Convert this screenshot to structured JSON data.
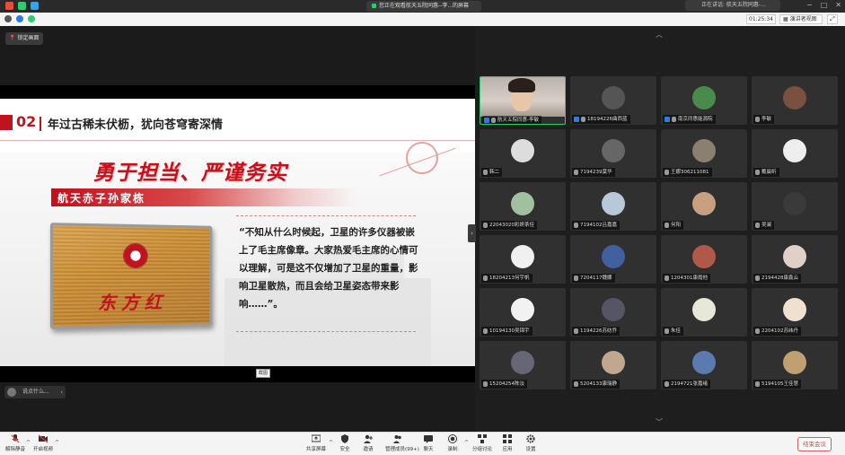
{
  "banner": {
    "text": "您正在观看航天五院同惠--李...的屏幕"
  },
  "speaking": {
    "text": "正在讲话: 航天五院同惠-..."
  },
  "info": {
    "timer": "01:25:34",
    "view_label": "演讲者视图"
  },
  "share": {
    "lock_label": "锁定画面",
    "slide": {
      "section_number": "02",
      "section_title": "年过古稀未伏枥，犹向苍穹寄深情",
      "slogan": "勇于担当、严谨务实",
      "name_banner": "航天赤子孙家栋",
      "plaque_text": "东方红",
      "quote": "“不知从什么时候起，卫星的许多仪器被嵌上了毛主席像章。大家热爱毛主席的心情可以理解，可是这不仅增加了卫星的重量，影响卫星散热，而且会给卫星姿态带来影响……”。"
    },
    "share_tag": "截图",
    "say_placeholder": "说点什么..."
  },
  "gallery": {
    "tiles": [
      {
        "name": "航天五院同惠-李敏",
        "camera": true,
        "host": true,
        "active": true
      },
      {
        "name": "18194226曲西蓝",
        "host": true,
        "color": "#555"
      },
      {
        "name": "南京同惠能源院",
        "host": true,
        "color": "#4a8a4a"
      },
      {
        "name": "李敏",
        "color": "#7a5040"
      },
      {
        "name": "韩二",
        "color": "#ddd"
      },
      {
        "name": "7194239莫华",
        "color": "#666"
      },
      {
        "name": "王娜306211081",
        "color": "#8a8070"
      },
      {
        "name": "戴晨昕",
        "color": "#eee"
      },
      {
        "name": "22043020彩妍茶佳",
        "color": "#a0c0a0"
      },
      {
        "name": "7194102吕嘉嘉",
        "color": "#b8c8d8"
      },
      {
        "name": "何阳",
        "color": "#c8a080"
      },
      {
        "name": "吴澜",
        "color": "#3a3a3a"
      },
      {
        "name": "18204213何宇帆",
        "color": "#f0f0f0"
      },
      {
        "name": "7204117魏娜",
        "color": "#4060a0"
      },
      {
        "name": "1204301康霞他",
        "color": "#b0584a"
      },
      {
        "name": "2194428康鑫云",
        "color": "#e0d0c8"
      },
      {
        "name": "10194130吴锦宇",
        "color": "#f2f2f2"
      },
      {
        "name": "1194226苏纺乔",
        "color": "#556"
      },
      {
        "name": "朱佳",
        "color": "#e8e8d8"
      },
      {
        "name": "2204102苏纬丹",
        "color": "#f0e0d0"
      },
      {
        "name": "15204254陈淡",
        "color": "#667"
      },
      {
        "name": "5204133康瑞静",
        "color": "#c0a890"
      },
      {
        "name": "2194721张嘉绪",
        "color": "#5a7ab0"
      },
      {
        "name": "5194105王佳慧",
        "color": "#c0a070"
      }
    ]
  },
  "toolbar": {
    "mute": "解除静音",
    "video": "开启视频",
    "share_screen": "共享屏幕",
    "security": "安全",
    "invite": "邀请",
    "manage": "管理成员(99+)",
    "chat": "聊天",
    "record": "录制",
    "breakout": "分组讨论",
    "apps": "应用",
    "settings": "设置",
    "end": "结束会议"
  }
}
